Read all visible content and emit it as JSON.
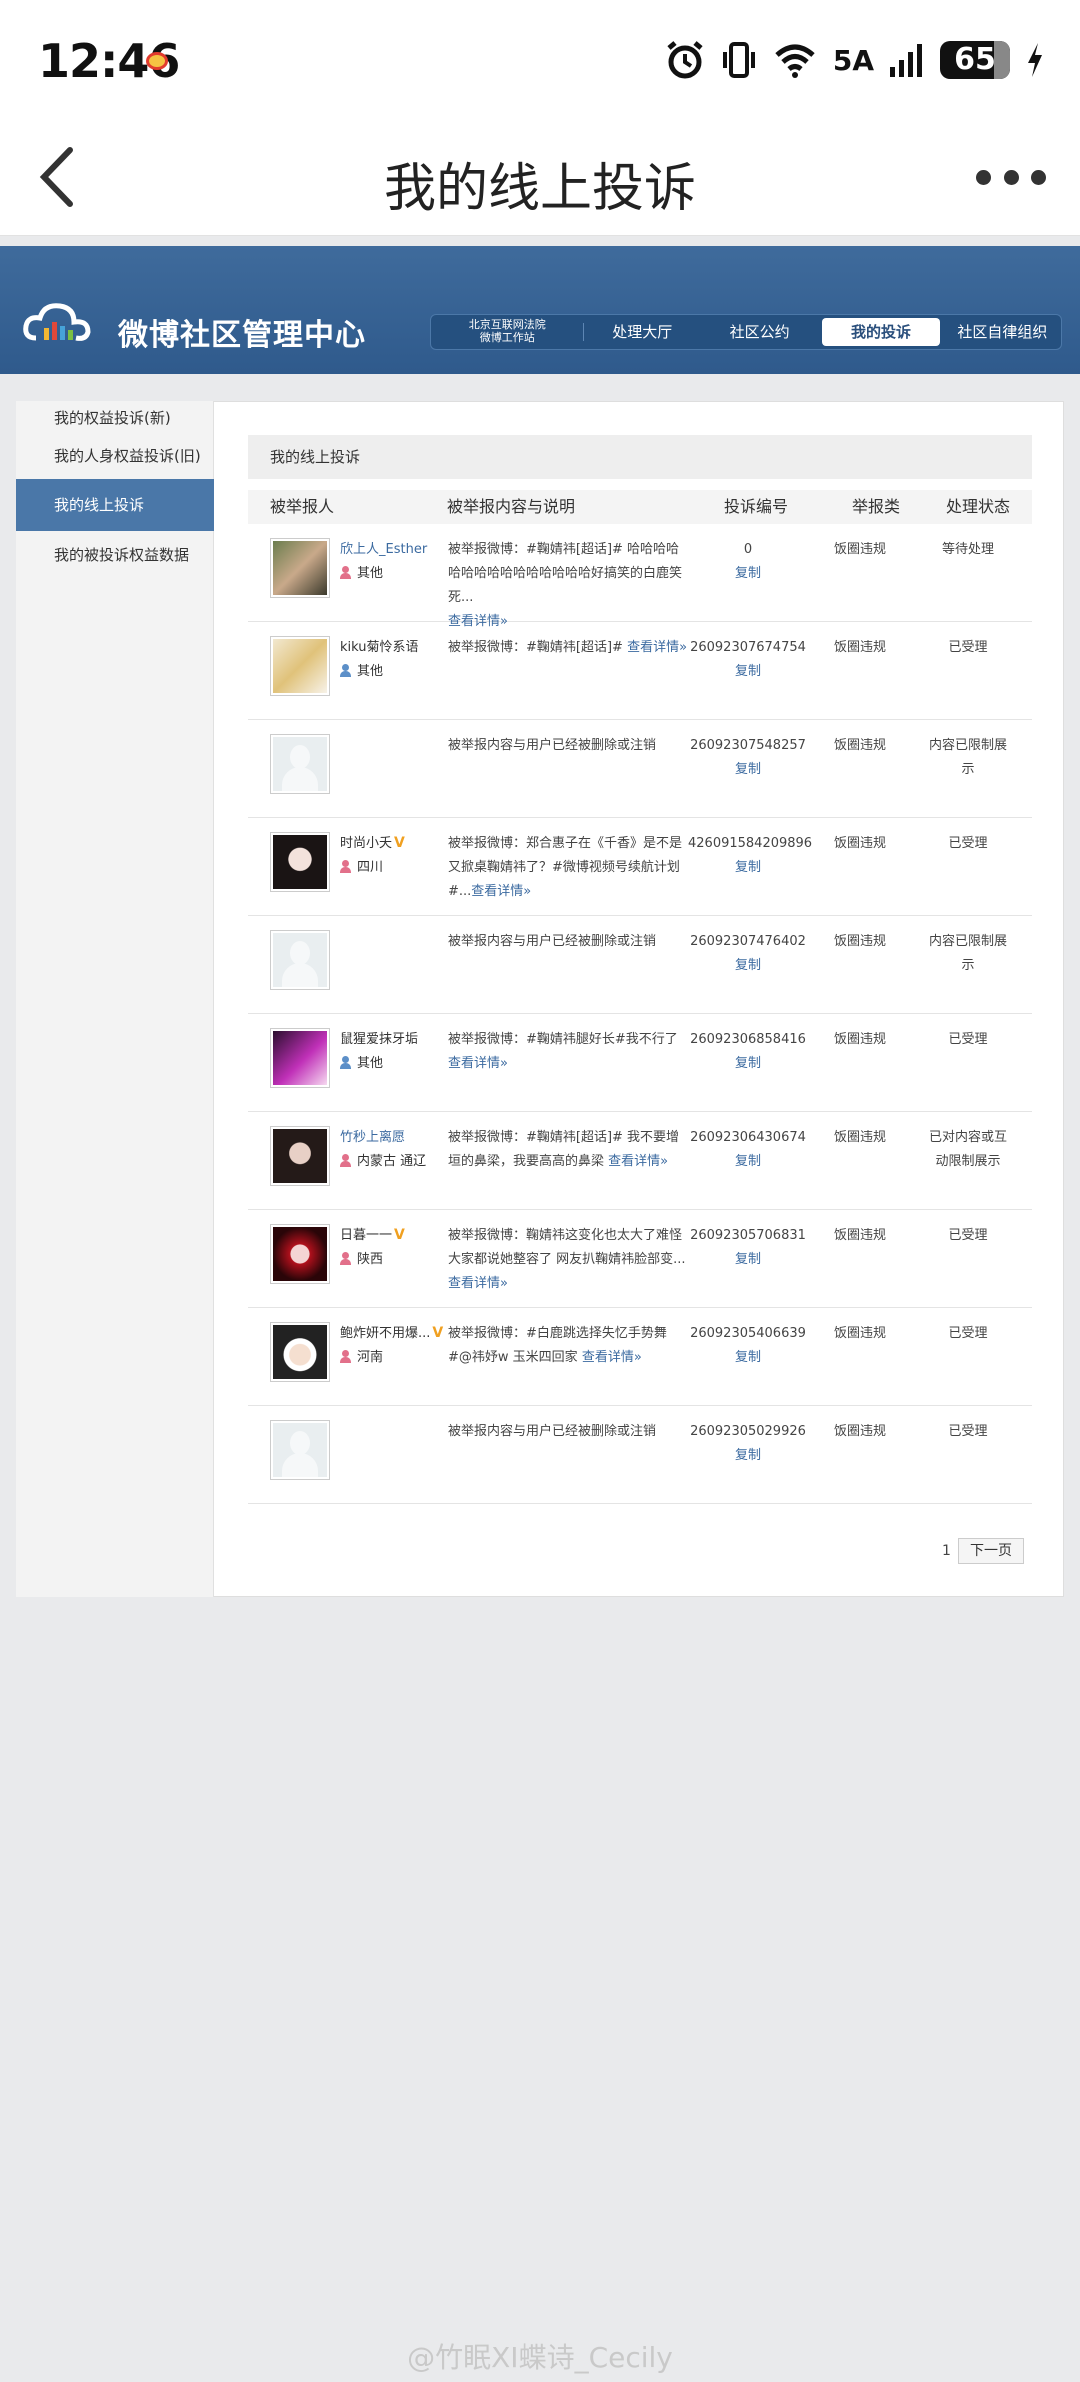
{
  "status_bar": {
    "time": "12:46",
    "network": "5A",
    "battery": "65"
  },
  "app_header": {
    "title": "我的线上投诉"
  },
  "site": {
    "title": "微博社区管理中心",
    "nav": [
      {
        "label_line1": "北京互联网法院",
        "label_line2": "微博工作站"
      },
      {
        "label": "处理大厅"
      },
      {
        "label": "社区公约"
      },
      {
        "label": "我的投诉"
      },
      {
        "label": "社区自律组织"
      }
    ]
  },
  "sidebar": {
    "items": [
      {
        "label": "我的权益投诉(新)"
      },
      {
        "label": "我的人身权益投诉(旧)"
      },
      {
        "label": "我的线上投诉"
      },
      {
        "label": "我的被投诉权益数据"
      }
    ]
  },
  "section": {
    "title": "我的线上投诉"
  },
  "table": {
    "headers": [
      "被举报人",
      "被举报内容与说明",
      "投诉编号",
      "举报类",
      "处理状态"
    ],
    "copy_label": "复制",
    "detail_label": "查看详情»",
    "rows": [
      {
        "name": "欣上人_Esther",
        "location": "其他",
        "content": "被举报微博：#鞠婧祎[超话]# 哈哈哈哈哈哈哈哈哈哈哈哈哈哈哈好搞笑的白鹿笑死...",
        "id": "0",
        "type": "饭圈违规",
        "status": "等待处理"
      },
      {
        "name": "kiku菊怜系语",
        "location": "其他",
        "content": "被举报微博：#鞠婧祎[超话]#",
        "id": "26092307674754",
        "type": "饭圈违规",
        "status": "已受理"
      },
      {
        "name": "",
        "location": "",
        "content": "被举报内容与用户已经被删除或注销",
        "id": "26092307548257",
        "type": "饭圈违规",
        "status": "内容已限制展示"
      },
      {
        "name": "时尚小夭",
        "location": "四川",
        "content": "被举报微博：郑合惠子在《千香》是不是又掀桌鞠婧祎了？#微博视频号续航计划#...",
        "id": "426091584209896",
        "type": "饭圈违规",
        "status": "已受理"
      },
      {
        "name": "",
        "location": "",
        "content": "被举报内容与用户已经被删除或注销",
        "id": "26092307476402",
        "type": "饭圈违规",
        "status": "内容已限制展示"
      },
      {
        "name": "鼠猩爱抹牙垢",
        "location": "其他",
        "content": "被举报微博：#鞠婧祎腿好长#我不行了",
        "id": "26092306858416",
        "type": "饭圈违规",
        "status": "已受理"
      },
      {
        "name": "竹秒上离愿",
        "location": "内蒙古 通辽",
        "content": "被举报微博：#鞠婧祎[超话]# 我不要增垣的鼻梁，我要高高的鼻梁",
        "id": "26092306430674",
        "type": "饭圈违规",
        "status": "已对内容或互动限制展示"
      },
      {
        "name": "日暮一一",
        "location": "陕西",
        "content": "被举报微博：鞠婧祎这变化也太大了难怪大家都说她整容了 网友扒鞠婧祎脸部变...",
        "id": "26092305706831",
        "type": "饭圈违规",
        "status": "已受理"
      },
      {
        "name": "鲍炸妍不用爆...",
        "location": "河南",
        "content": "被举报微博：#白鹿跳选择失忆手势舞#@祎妤w 玉米四回家",
        "id": "26092305406639",
        "type": "饭圈违规",
        "status": "已受理"
      },
      {
        "name": "",
        "location": "",
        "content": "被举报内容与用户已经被删除或注销",
        "id": "26092305029926",
        "type": "饭圈违规",
        "status": "已受理"
      }
    ]
  },
  "pager": {
    "current": "1",
    "next_label": "下一页"
  },
  "watermark": "@竹眠XI蝶诗_Cecily"
}
